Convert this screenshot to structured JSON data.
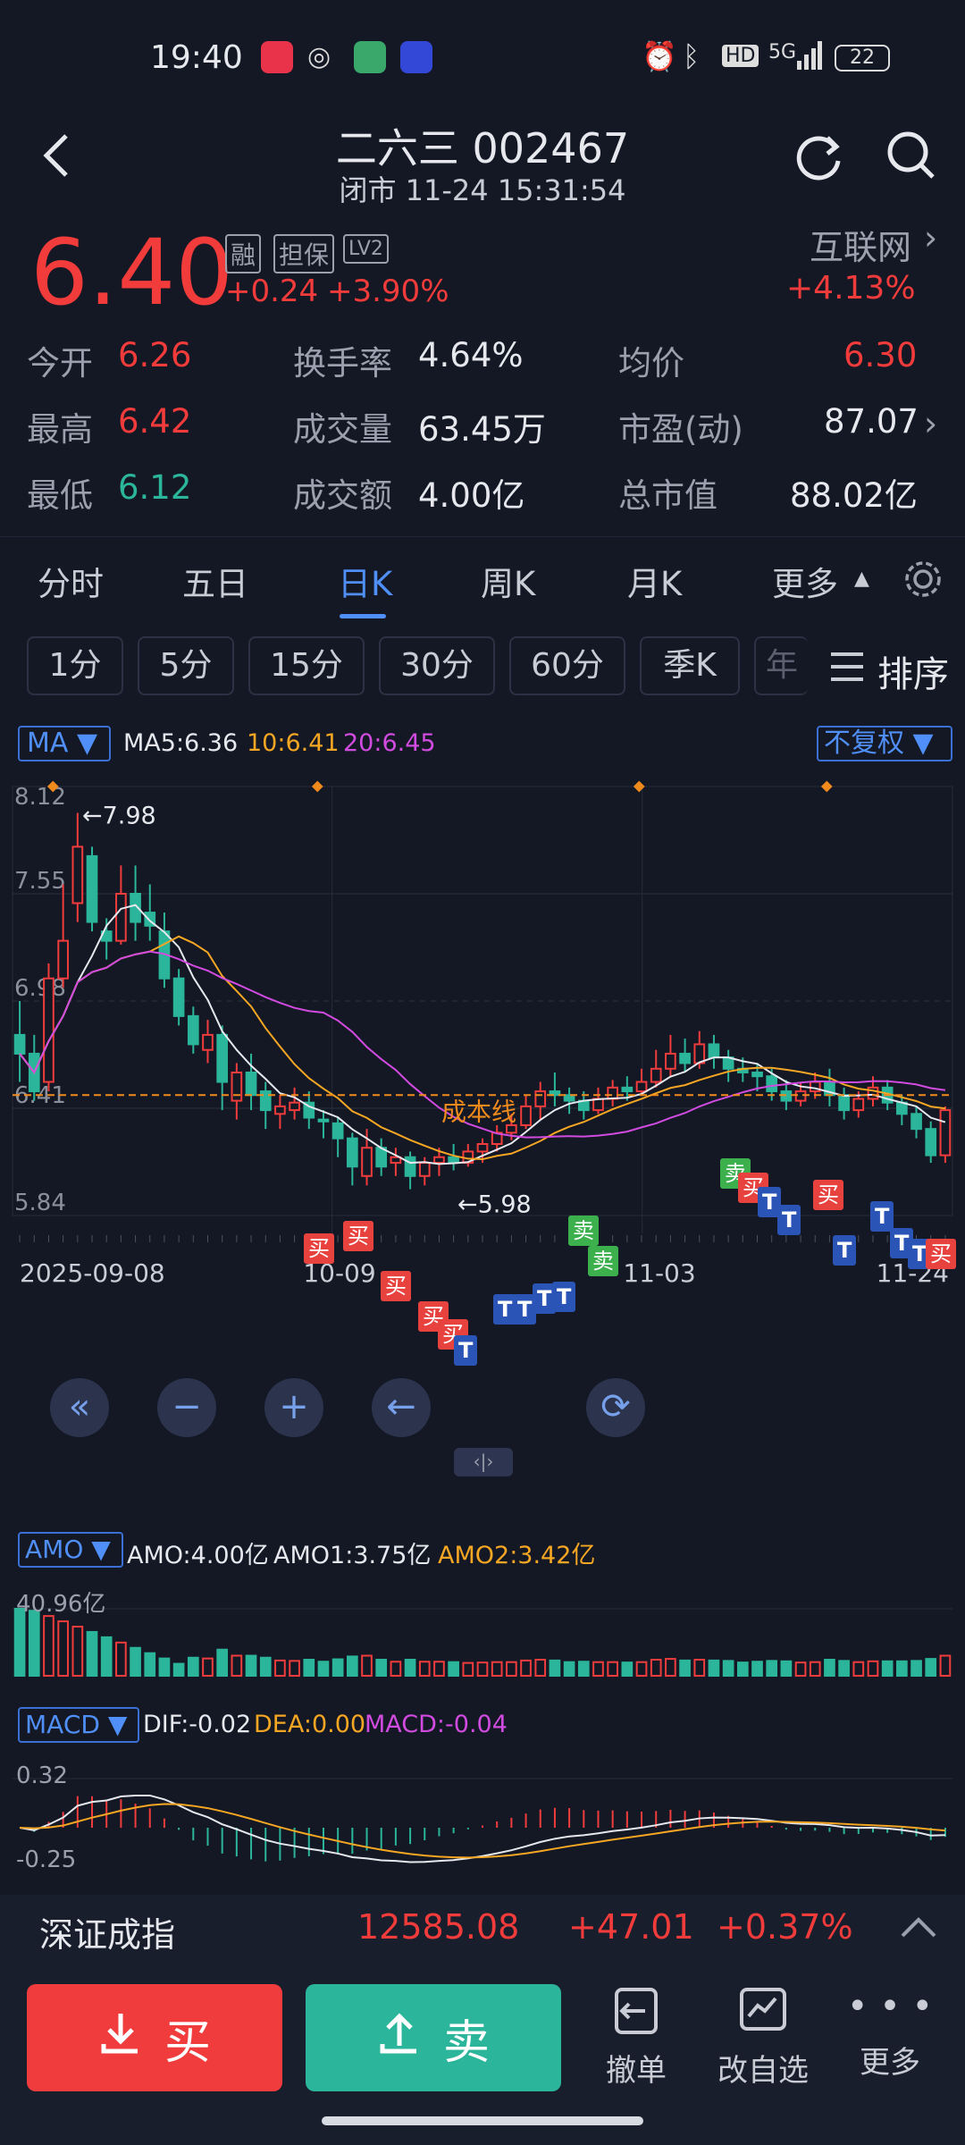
{
  "status_bar": {
    "time": "19:40",
    "battery": "22",
    "network": "5G",
    "hd": "HD"
  },
  "header": {
    "title": "二六三 002467",
    "subtitle": "闭市 11-24 15:31:54"
  },
  "quote": {
    "price": "6.40",
    "change": "+0.24",
    "change_pct": "+3.90%",
    "tags": [
      "融",
      "担保",
      "LV2"
    ],
    "sector_name": "互联网",
    "sector_change": "+4.13%"
  },
  "stats": {
    "open_label": "今开",
    "open": "6.26",
    "high_label": "最高",
    "high": "6.42",
    "low_label": "最低",
    "low": "6.12",
    "turnover_label": "换手率",
    "turnover": "4.64%",
    "volume_label": "成交量",
    "volume": "63.45万",
    "amount_label": "成交额",
    "amount": "4.00亿",
    "avg_label": "均价",
    "avg": "6.30",
    "pe_label": "市盈(动)",
    "pe": "87.07",
    "mktcap_label": "总市值",
    "mktcap": "88.02亿"
  },
  "period_tabs": [
    "分时",
    "五日",
    "日K",
    "周K",
    "月K",
    "更多"
  ],
  "active_period": "日K",
  "intervals": [
    "1分",
    "5分",
    "15分",
    "30分",
    "60分",
    "季K",
    "年"
  ],
  "sort_label": "排序",
  "chart_header": {
    "indicator": "MA",
    "ma5": "MA5:6.36",
    "ma10": "10:6.41",
    "ma20": "20:6.45",
    "adjust": "不复权"
  },
  "chart_data": {
    "type": "candlestick",
    "y_ticks": [
      "8.12",
      "7.55",
      "6.98",
      "6.41",
      "5.84"
    ],
    "x_ticks": [
      "2025-09-08",
      "10-09",
      "11-03",
      "11-24"
    ],
    "ylim": [
      5.84,
      8.12
    ],
    "max_label": "7.98",
    "min_label": "5.98",
    "cost_line_label": "成本线",
    "cost_line_value": 6.48,
    "candles": [
      [
        6.8,
        6.7,
        6.98,
        6.55
      ],
      [
        6.7,
        6.5,
        6.8,
        6.45
      ],
      [
        6.55,
        7.1,
        7.18,
        6.5
      ],
      [
        7.1,
        7.3,
        7.6,
        7.05
      ],
      [
        7.5,
        7.8,
        7.98,
        7.4
      ],
      [
        7.75,
        7.4,
        7.8,
        7.35
      ],
      [
        7.35,
        7.3,
        7.42,
        7.2
      ],
      [
        7.3,
        7.55,
        7.7,
        7.28
      ],
      [
        7.55,
        7.4,
        7.7,
        7.3
      ],
      [
        7.45,
        7.38,
        7.6,
        7.3
      ],
      [
        7.35,
        7.1,
        7.45,
        7.05
      ],
      [
        7.1,
        6.9,
        7.15,
        6.85
      ],
      [
        6.9,
        6.75,
        6.95,
        6.7
      ],
      [
        6.72,
        6.8,
        6.88,
        6.65
      ],
      [
        6.8,
        6.55,
        6.85,
        6.4
      ],
      [
        6.45,
        6.6,
        6.65,
        6.35
      ],
      [
        6.6,
        6.48,
        6.7,
        6.4
      ],
      [
        6.5,
        6.4,
        6.55,
        6.3
      ],
      [
        6.38,
        6.42,
        6.48,
        6.3
      ],
      [
        6.4,
        6.44,
        6.52,
        6.35
      ],
      [
        6.44,
        6.36,
        6.5,
        6.3
      ],
      [
        6.35,
        6.34,
        6.4,
        6.25
      ],
      [
        6.33,
        6.25,
        6.36,
        6.15
      ],
      [
        6.25,
        6.1,
        6.28,
        6.0
      ],
      [
        6.05,
        6.2,
        6.3,
        6.0
      ],
      [
        6.2,
        6.1,
        6.25,
        6.05
      ],
      [
        6.12,
        6.15,
        6.2,
        6.05
      ],
      [
        6.15,
        6.05,
        6.18,
        5.98
      ],
      [
        6.05,
        6.12,
        6.15,
        6.0
      ],
      [
        6.12,
        6.15,
        6.2,
        6.05
      ],
      [
        6.15,
        6.12,
        6.22,
        6.08
      ],
      [
        6.12,
        6.18,
        6.22,
        6.1
      ],
      [
        6.18,
        6.22,
        6.25,
        6.12
      ],
      [
        6.22,
        6.28,
        6.32,
        6.18
      ],
      [
        6.28,
        6.32,
        6.38,
        6.24
      ],
      [
        6.32,
        6.42,
        6.48,
        6.3
      ],
      [
        6.42,
        6.5,
        6.55,
        6.35
      ],
      [
        6.5,
        6.48,
        6.6,
        6.42
      ],
      [
        6.48,
        6.45,
        6.52,
        6.38
      ],
      [
        6.45,
        6.4,
        6.5,
        6.35
      ],
      [
        6.4,
        6.46,
        6.52,
        6.38
      ],
      [
        6.46,
        6.52,
        6.56,
        6.42
      ],
      [
        6.52,
        6.5,
        6.58,
        6.45
      ],
      [
        6.5,
        6.55,
        6.62,
        6.48
      ],
      [
        6.55,
        6.62,
        6.72,
        6.52
      ],
      [
        6.62,
        6.7,
        6.8,
        6.58
      ],
      [
        6.7,
        6.65,
        6.78,
        6.6
      ],
      [
        6.65,
        6.75,
        6.82,
        6.62
      ],
      [
        6.75,
        6.68,
        6.8,
        6.62
      ],
      [
        6.68,
        6.62,
        6.72,
        6.55
      ],
      [
        6.62,
        6.6,
        6.68,
        6.55
      ],
      [
        6.6,
        6.58,
        6.65,
        6.5
      ],
      [
        6.58,
        6.5,
        6.62,
        6.45
      ],
      [
        6.5,
        6.45,
        6.56,
        6.4
      ],
      [
        6.45,
        6.5,
        6.55,
        6.42
      ],
      [
        6.5,
        6.55,
        6.6,
        6.46
      ],
      [
        6.55,
        6.48,
        6.62,
        6.42
      ],
      [
        6.48,
        6.4,
        6.52,
        6.35
      ],
      [
        6.4,
        6.46,
        6.5,
        6.36
      ],
      [
        6.46,
        6.52,
        6.58,
        6.42
      ],
      [
        6.52,
        6.44,
        6.56,
        6.4
      ],
      [
        6.44,
        6.38,
        6.48,
        6.32
      ],
      [
        6.38,
        6.3,
        6.42,
        6.25
      ],
      [
        6.3,
        6.16,
        6.34,
        6.12
      ],
      [
        6.16,
        6.4,
        6.42,
        6.12
      ]
    ]
  },
  "amo": {
    "label": "AMO",
    "amo": "AMO:4.00亿",
    "amo1": "AMO1:3.75亿",
    "amo2": "AMO2:3.42亿",
    "max": "40.96亿"
  },
  "macd": {
    "label": "MACD",
    "dif": "DIF:-0.02",
    "dea": "DEA:0.00",
    "macd": "MACD:-0.04",
    "top": "0.32",
    "bottom": "-0.25"
  },
  "index_bar": {
    "name": "深证成指",
    "value": "12585.08",
    "change": "+47.01",
    "pct": "+0.37%"
  },
  "actions": {
    "buy": "买",
    "sell": "卖",
    "cancel": "撤单",
    "watchlist": "改自选",
    "more": "更多"
  }
}
